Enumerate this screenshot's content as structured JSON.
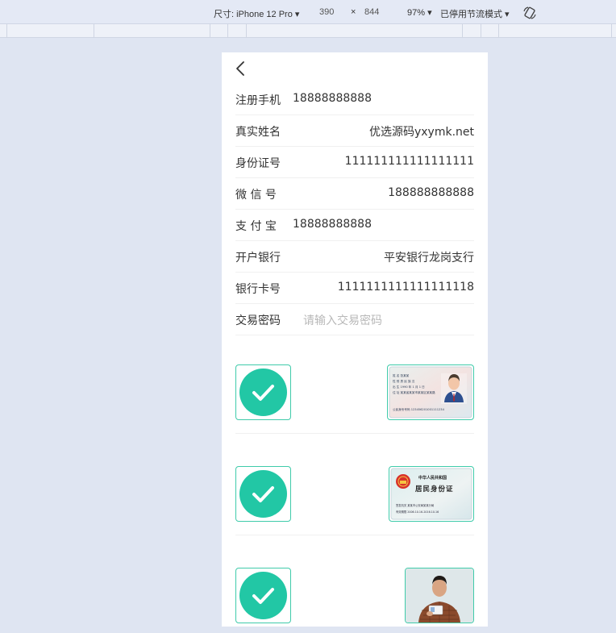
{
  "devtools": {
    "device_label": "尺寸: iPhone 12 Pro ▾",
    "width": "390",
    "times": "×",
    "height": "844",
    "zoom": "97% ▾",
    "throttle": "已停用节流模式 ▾"
  },
  "form": {
    "rows": [
      {
        "label": "注册手机",
        "value": "18888888888",
        "align": "left"
      },
      {
        "label": "真实姓名",
        "value": "优选源码yxymk.net",
        "align": "right"
      },
      {
        "label": "身份证号",
        "value": "111111111111111111",
        "align": "right"
      },
      {
        "label": "微 信 号",
        "value": "188888888888",
        "align": "right"
      },
      {
        "label": "支 付 宝",
        "value": "18888888888",
        "align": "left"
      },
      {
        "label": "开户银行",
        "value": "平安银行龙岗支行",
        "align": "right"
      },
      {
        "label": "银行卡号",
        "value": "1111111111111111118",
        "align": "right"
      }
    ],
    "password": {
      "label": "交易密码",
      "placeholder": "请输入交易密码"
    }
  },
  "id_card_back": {
    "name_label": "姓 名",
    "name_value": "张某某",
    "sex_label": "性 别",
    "sex_value": "男",
    "ethnic_label": "民 族",
    "ethnic_value": "汉",
    "birth_label": "出 生",
    "birth_value": "1990 年 1 月 1 日",
    "address_label": "住 址",
    "address_value": "某某省某某市某某区某某路",
    "number_label": "公民身份号码",
    "number_value": "123456201001111234"
  },
  "id_card_front": {
    "country": "中华人民共和国",
    "title": "居民身份证",
    "authority_label": "签发机关",
    "authority_value": "某某市公安局某某分局",
    "validity_label": "有效期限",
    "validity_value": "2006.10.16-2016.10.16"
  },
  "colors": {
    "accent": "#22c7a5",
    "border": "#3fcbaa",
    "placeholder": "#b8b8b8"
  }
}
